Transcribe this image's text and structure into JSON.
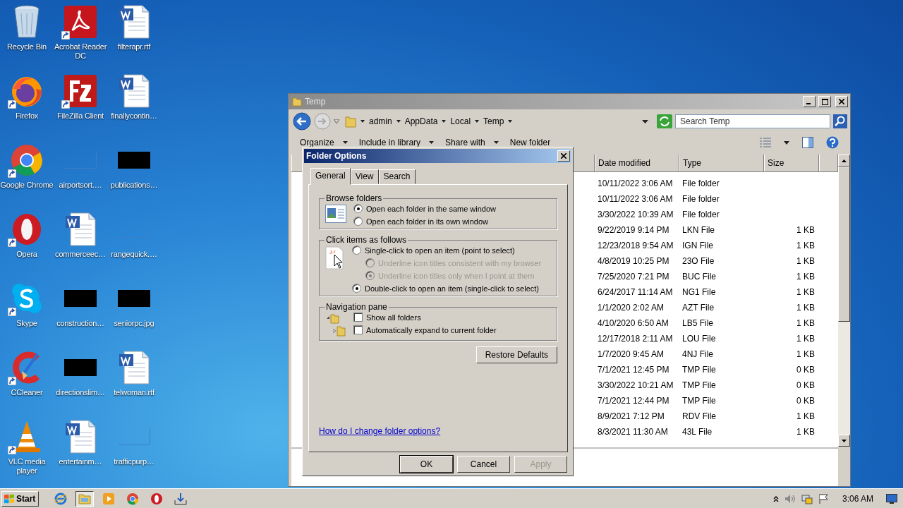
{
  "desktop_icons": [
    {
      "label": "Recycle Bin",
      "kind": "recycle",
      "shortcut": false
    },
    {
      "label": "Acrobat Reader DC",
      "kind": "acrobat",
      "shortcut": true
    },
    {
      "label": "filterapr.rtf",
      "kind": "document",
      "shortcut": false
    },
    {
      "label": "Firefox",
      "kind": "firefox",
      "shortcut": true
    },
    {
      "label": "FileZilla Client",
      "kind": "filezilla",
      "shortcut": true
    },
    {
      "label": "finallycontin…",
      "kind": "document",
      "shortcut": false
    },
    {
      "label": "Google Chrome",
      "kind": "chrome",
      "shortcut": true
    },
    {
      "label": "airportsort.…",
      "kind": "blank",
      "shortcut": false
    },
    {
      "label": "publications…",
      "kind": "redacted",
      "shortcut": false
    },
    {
      "label": "Opera",
      "kind": "opera",
      "shortcut": true
    },
    {
      "label": "commerceec…",
      "kind": "document",
      "shortcut": false
    },
    {
      "label": "rangequick.…",
      "kind": "blank",
      "shortcut": false
    },
    {
      "label": "Skype",
      "kind": "skype",
      "shortcut": true
    },
    {
      "label": "construction…",
      "kind": "redacted",
      "shortcut": false
    },
    {
      "label": "seniorpc.jpg",
      "kind": "redacted",
      "shortcut": false
    },
    {
      "label": "CCleaner",
      "kind": "ccleaner",
      "shortcut": true
    },
    {
      "label": "directionslim…",
      "kind": "redacted",
      "shortcut": false
    },
    {
      "label": "telwoman.rtf",
      "kind": "document",
      "shortcut": false
    },
    {
      "label": "VLC media player",
      "kind": "vlc",
      "shortcut": true
    },
    {
      "label": "entertainm…",
      "kind": "document",
      "shortcut": false
    },
    {
      "label": "trafficpurp…",
      "kind": "blank",
      "shortcut": false
    }
  ],
  "explorer": {
    "title": "Temp",
    "breadcrumb": [
      "admin",
      "AppData",
      "Local",
      "Temp"
    ],
    "search": {
      "placeholder": "Search Temp"
    },
    "toolbar": [
      {
        "label": "Organize",
        "dropdown": true
      },
      {
        "label": "Include in library",
        "dropdown": true
      },
      {
        "label": "Share with",
        "dropdown": true
      },
      {
        "label": "New folder",
        "dropdown": false
      }
    ],
    "columns": [
      "Date modified",
      "Type",
      "Size"
    ],
    "rows": [
      {
        "date": "10/11/2022 3:06 AM",
        "type": "File folder",
        "size": ""
      },
      {
        "date": "10/11/2022 3:06 AM",
        "type": "File folder",
        "size": ""
      },
      {
        "date": "3/30/2022 10:39 AM",
        "type": "File folder",
        "size": ""
      },
      {
        "date": "9/22/2019 9:14 PM",
        "type": "LKN File",
        "size": "1 KB"
      },
      {
        "date": "12/23/2018 9:54 AM",
        "type": "IGN File",
        "size": "1 KB"
      },
      {
        "date": "4/8/2019 10:25 PM",
        "type": "23O File",
        "size": "1 KB"
      },
      {
        "date": "7/25/2020 7:21 PM",
        "type": "BUC File",
        "size": "1 KB"
      },
      {
        "date": "6/24/2017 11:14 AM",
        "type": "NG1 File",
        "size": "1 KB"
      },
      {
        "date": "1/1/2020 2:02 AM",
        "type": "AZT File",
        "size": "1 KB"
      },
      {
        "date": "4/10/2020 6:50 AM",
        "type": "LB5 File",
        "size": "1 KB"
      },
      {
        "date": "12/17/2018 2:11 AM",
        "type": "LOU File",
        "size": "1 KB"
      },
      {
        "date": "1/7/2020 9:45 AM",
        "type": "4NJ File",
        "size": "1 KB"
      },
      {
        "date": "7/1/2021 12:45 PM",
        "type": "TMP File",
        "size": "0 KB"
      },
      {
        "date": "3/30/2022 10:21 AM",
        "type": "TMP File",
        "size": "0 KB"
      },
      {
        "date": "7/1/2021 12:44 PM",
        "type": "TMP File",
        "size": "0 KB"
      },
      {
        "date": "8/9/2021 7:12 PM",
        "type": "RDV File",
        "size": "1 KB"
      },
      {
        "date": "8/3/2021 11:30 AM",
        "type": "43L File",
        "size": "1 KB"
      }
    ]
  },
  "dialog": {
    "title": "Folder Options",
    "tabs": [
      {
        "label": "General",
        "selected": true
      },
      {
        "label": "View",
        "selected": false
      },
      {
        "label": "Search",
        "selected": false
      }
    ],
    "browse_folders": {
      "title": "Browse folders",
      "options": [
        {
          "label": "Open each folder in the same window",
          "selected": true,
          "disabled": false
        },
        {
          "label": "Open each folder in its own window",
          "selected": false,
          "disabled": false
        }
      ]
    },
    "click_items": {
      "title": "Click items as follows",
      "options": [
        {
          "label": "Single-click to open an item (point to select)",
          "selected": false,
          "disabled": false,
          "children": [
            {
              "label": "Underline icon titles consistent with my browser",
              "selected": false,
              "disabled": true
            },
            {
              "label": "Underline icon titles only when I point at them",
              "selected": true,
              "disabled": true
            }
          ]
        },
        {
          "label": "Double-click to open an item (single-click to select)",
          "selected": true,
          "disabled": false
        }
      ]
    },
    "navigation_pane": {
      "title": "Navigation pane",
      "checkboxes": [
        {
          "label": "Show all folders",
          "checked": false
        },
        {
          "label": "Automatically expand to current folder",
          "checked": false
        }
      ]
    },
    "restore_button": "Restore Defaults",
    "help_link": "How do I change folder options?",
    "buttons": [
      {
        "label": "OK",
        "disabled": false,
        "default": true
      },
      {
        "label": "Cancel",
        "disabled": false,
        "default": false
      },
      {
        "label": "Apply",
        "disabled": true,
        "default": false
      }
    ]
  },
  "taskbar": {
    "start": "Start",
    "apps": [
      {
        "kind": "ie",
        "selected": false
      },
      {
        "kind": "explorer",
        "selected": true
      },
      {
        "kind": "media",
        "selected": false
      },
      {
        "kind": "chrome",
        "selected": false
      },
      {
        "kind": "opera",
        "selected": false
      },
      {
        "kind": "download",
        "selected": false
      }
    ],
    "clock": "3:06 AM"
  }
}
